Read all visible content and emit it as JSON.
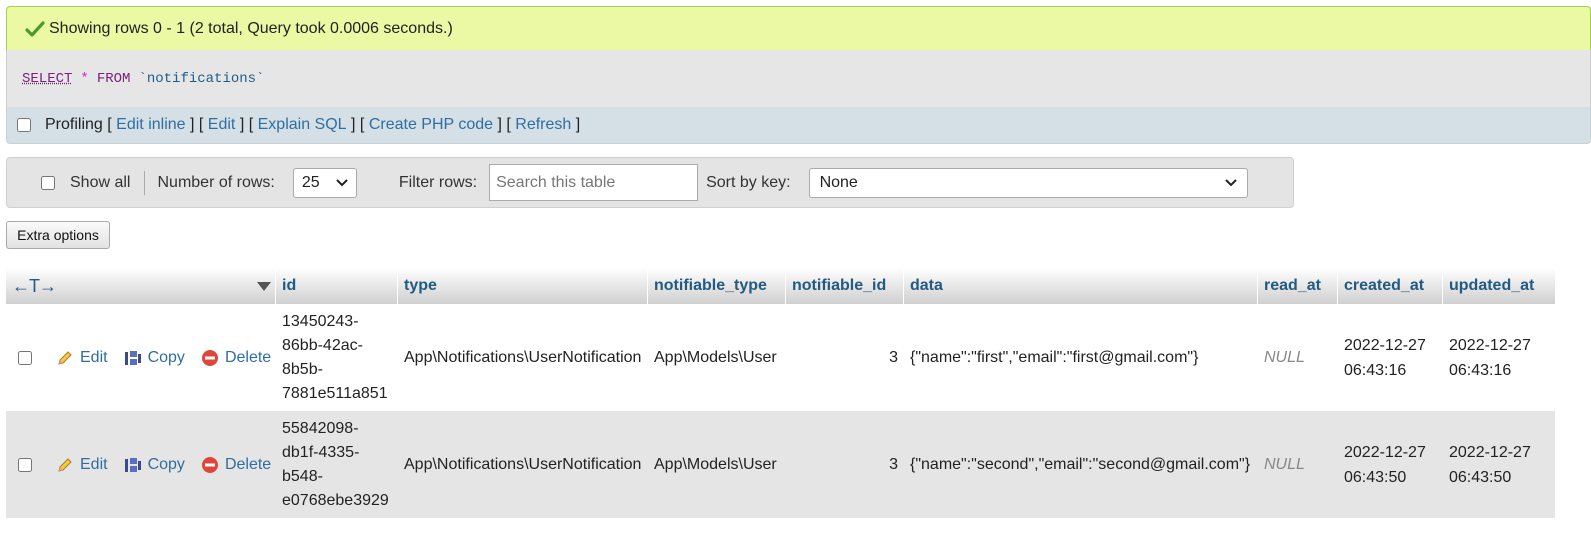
{
  "message": {
    "text": "Showing rows 0 - 1 (2 total, Query took 0.0006 seconds.)"
  },
  "sql": {
    "select": "SELECT",
    "star": "*",
    "from": "FROM",
    "table": "`notifications`"
  },
  "profiling": {
    "label": "Profiling",
    "links": [
      "Edit inline",
      "Edit",
      "Explain SQL",
      "Create PHP code",
      "Refresh"
    ]
  },
  "nav": {
    "show_all": "Show all",
    "rows_label": "Number of rows:",
    "rows_value": "25",
    "filter_label": "Filter rows:",
    "filter_placeholder": "Search this table",
    "sort_label": "Sort by key:",
    "sort_value": "None"
  },
  "extra_options": "Extra options",
  "table": {
    "arrows": "←T→",
    "columns": [
      "id",
      "type",
      "notifiable_type",
      "notifiable_id",
      "data",
      "read_at",
      "created_at",
      "updated_at"
    ],
    "actions": {
      "edit": "Edit",
      "copy": "Copy",
      "delete": "Delete"
    },
    "rows": [
      {
        "id_lines": [
          "13450243-",
          "86bb-42ac-",
          "8b5b-",
          "7881e511a851"
        ],
        "type": "App\\Notifications\\UserNotification",
        "notifiable_type": "App\\Models\\User",
        "notifiable_id": "3",
        "data": "{\"name\":\"first\",\"email\":\"first@gmail.com\"}",
        "read_at": "NULL",
        "created_date": "2022-12-27",
        "created_time": "06:43:16",
        "updated_date": "2022-12-27",
        "updated_time": "06:43:16"
      },
      {
        "id_lines": [
          "55842098-",
          "db1f-4335-",
          "b548-",
          "e0768ebe3929"
        ],
        "type": "App\\Notifications\\UserNotification",
        "notifiable_type": "App\\Models\\User",
        "notifiable_id": "3",
        "data": "{\"name\":\"second\",\"email\":\"second@gmail.com\"}",
        "read_at": "NULL",
        "created_date": "2022-12-27",
        "created_time": "06:43:50",
        "updated_date": "2022-12-27",
        "updated_time": "06:43:50"
      }
    ]
  }
}
